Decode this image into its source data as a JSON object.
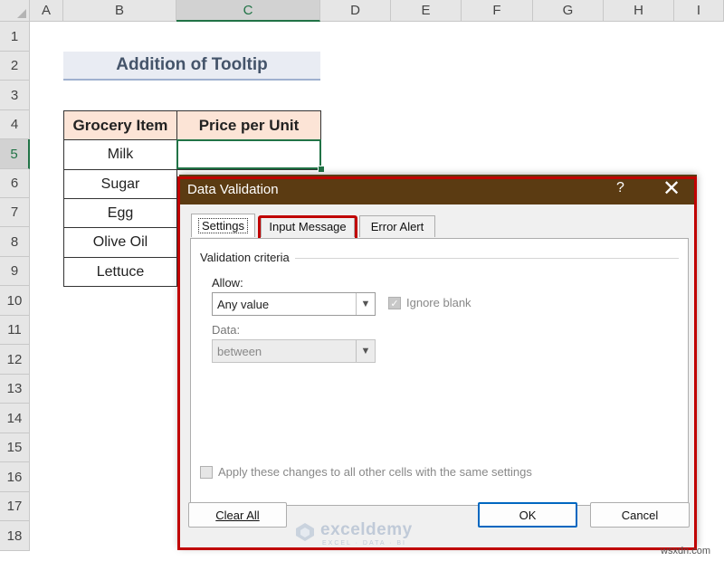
{
  "sheet": {
    "columns": [
      "A",
      "B",
      "C",
      "D",
      "E",
      "F",
      "G",
      "H",
      "I"
    ],
    "rows": [
      "1",
      "2",
      "3",
      "4",
      "5",
      "6",
      "7",
      "8",
      "9",
      "10",
      "11",
      "12",
      "13",
      "14",
      "15",
      "16",
      "17",
      "18"
    ],
    "title": "Addition of Tooltip",
    "table": {
      "headers": [
        "Grocery Item",
        "Price per Unit"
      ],
      "items": [
        "Milk",
        "Sugar",
        "Egg",
        "Olive Oil",
        "Lettuce"
      ]
    }
  },
  "dialog": {
    "title": "Data Validation",
    "help": "?",
    "close": "✕",
    "tabs": [
      "Settings",
      "Input Message",
      "Error Alert"
    ],
    "group_label": "Validation criteria",
    "allow_label": "Allow:",
    "allow_value": "Any value",
    "ignore_blank_label": "Ignore blank",
    "data_label": "Data:",
    "data_value": "between",
    "apply_label": "Apply these changes to all other cells with the same settings",
    "buttons": {
      "clear_all": "Clear All",
      "ok": "OK",
      "cancel": "Cancel"
    }
  },
  "watermark": {
    "brand": "exceldemy",
    "tagline": "EXCEL · DATA · BI"
  },
  "credit": "wsxdn.com",
  "colors": {
    "accent_green": "#217346",
    "highlight_red": "#c00000",
    "titlebar": "#5b3b12",
    "table_header_fill": "#fce4d6"
  }
}
